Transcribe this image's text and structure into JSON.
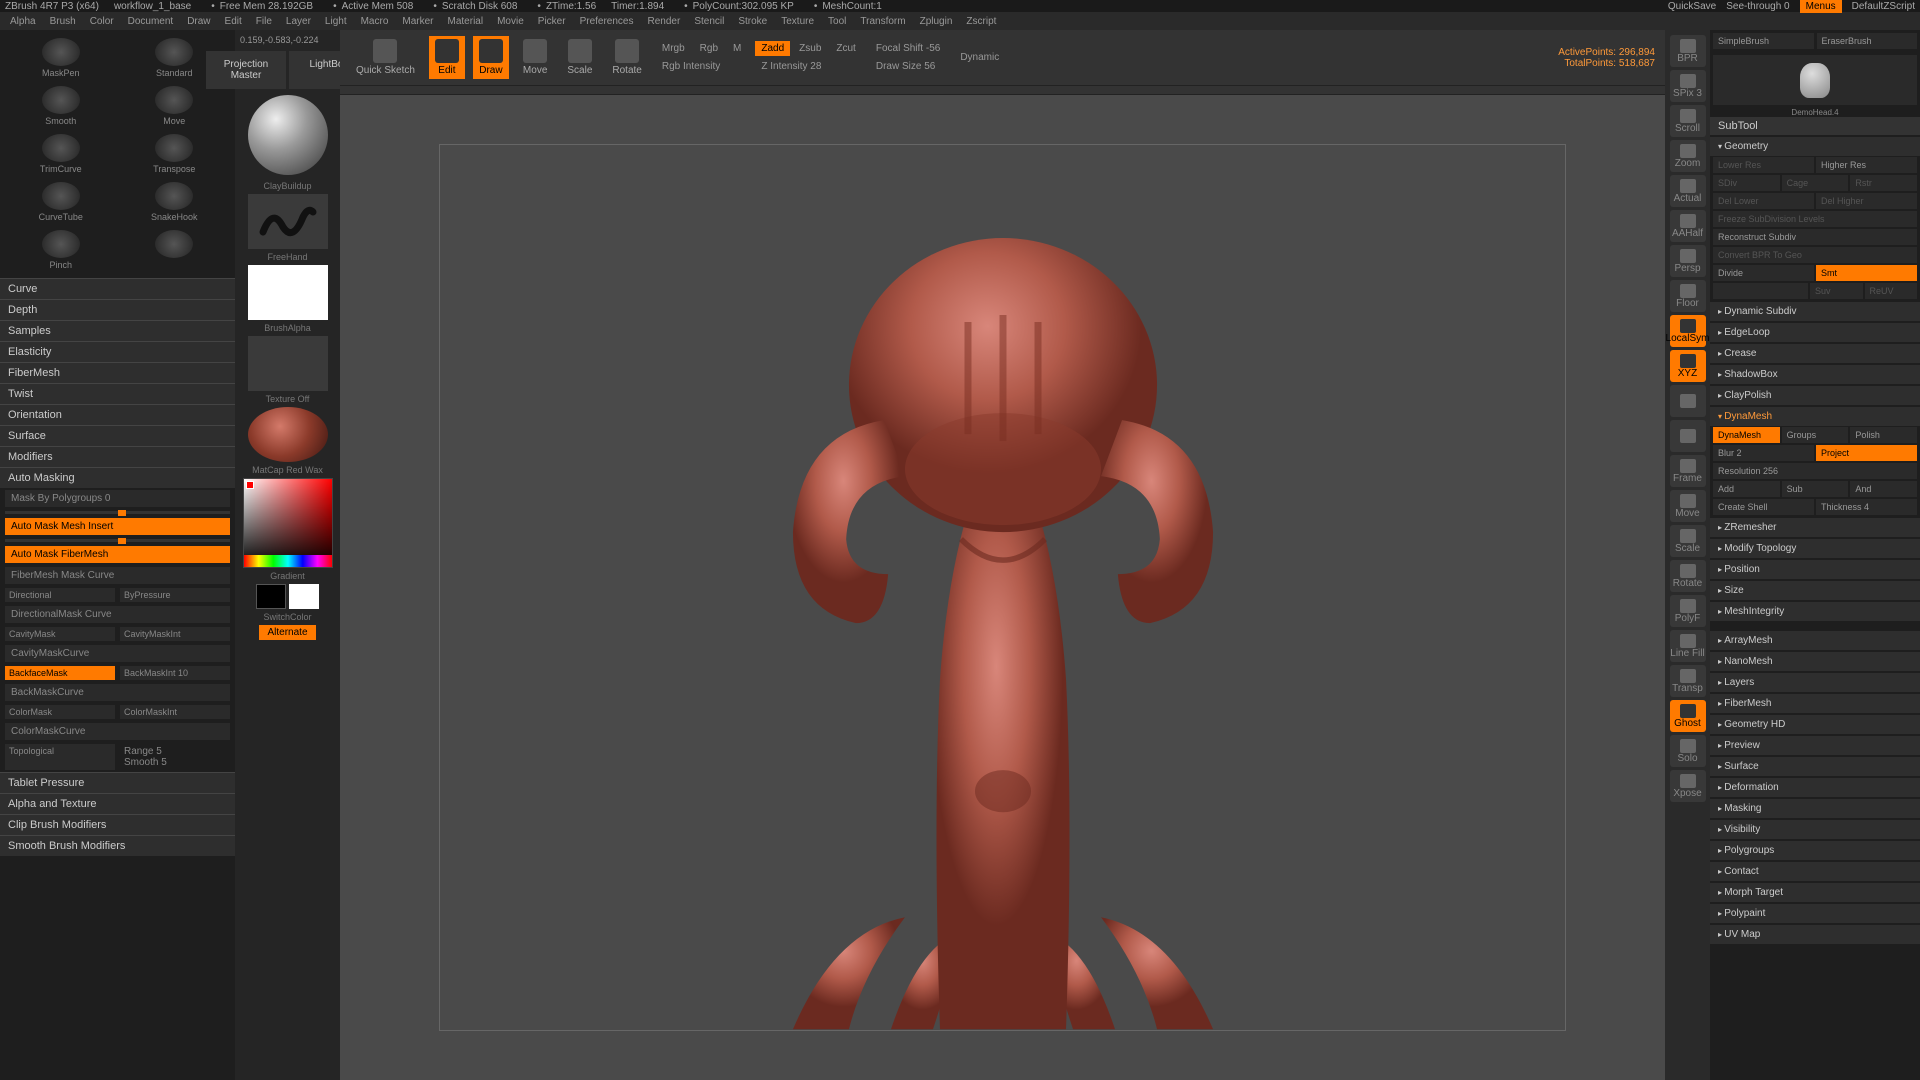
{
  "titlebar": {
    "app": "ZBrush 4R7 P3 (x64)",
    "file": "workflow_1_base",
    "mem_free": "Free Mem 28.192GB",
    "mem_active": "Active Mem 508",
    "scratch": "Scratch Disk 608",
    "ztime": "ZTime:1.56",
    "timer": "Timer:1.894",
    "polycount": "PolyCount:302.095 KP",
    "meshcount": "MeshCount:1",
    "quicksave": "QuickSave",
    "seethrough": "See-through  0",
    "menus": "Menus",
    "script": "DefaultZScript"
  },
  "menubar": [
    "Alpha",
    "Brush",
    "Color",
    "Document",
    "Draw",
    "Edit",
    "File",
    "Layer",
    "Light",
    "Macro",
    "Marker",
    "Material",
    "Movie",
    "Picker",
    "Preferences",
    "Render",
    "Stencil",
    "Stroke",
    "Texture",
    "Tool",
    "Transform",
    "Zplugin",
    "Zscript"
  ],
  "brushes": [
    {
      "label": "MaskPen"
    },
    {
      "label": "Standard"
    },
    {
      "label": "Smooth"
    },
    {
      "label": "Move"
    },
    {
      "label": "TrimCurve"
    },
    {
      "label": "Transpose"
    },
    {
      "label": "CurveTube"
    },
    {
      "label": "SnakeHook"
    },
    {
      "label": "Pinch"
    },
    {
      "label": ""
    }
  ],
  "left_sections": [
    "Curve",
    "Depth",
    "Samples",
    "Elasticity",
    "FiberMesh",
    "Twist",
    "Orientation",
    "Surface",
    "Modifiers"
  ],
  "automask": {
    "header": "Auto Masking",
    "polygroups": "Mask By Polygroups 0",
    "insert": "Auto Mask Mesh Insert",
    "fiber": "Auto Mask FiberMesh",
    "fibercurve": "FiberMesh Mask Curve",
    "directional": "Directional",
    "dirpressure": "ByPressure",
    "dircurve": "DirectionalMask Curve",
    "cavity": "CavityMask",
    "cavityint": "CavityMaskInt",
    "cavitycurve": "CavityMaskCurve",
    "backface": "BackfaceMask",
    "backint": "BackMaskInt 10",
    "backcurve": "BackMaskCurve",
    "colormask": "ColorMask",
    "colorint": "ColorMaskInt",
    "colorcurve": "ColorMaskCurve",
    "topo": "Topological",
    "range": "Range 5",
    "smooth": "Smooth 5"
  },
  "bottom_sections": [
    "Tablet Pressure",
    "Alpha and Texture",
    "Clip Brush Modifiers",
    "Smooth Brush Modifiers"
  ],
  "col2": {
    "coords": "0.159,-0.583,-0.224",
    "proj": "Projection Master",
    "lightbox": "LightBox",
    "brush": "ClayBuildup",
    "stroke": "FreeHand",
    "alpha": "BrushAlpha",
    "texture": "Texture Off",
    "matcap": "MatCap Red Wax",
    "gradient": "Gradient",
    "switch": "SwitchColor",
    "alternate": "Alternate"
  },
  "toolbar": {
    "quick": "Quick Sketch",
    "edit": "Edit",
    "draw": "Draw",
    "move": "Move",
    "scale": "Scale",
    "rotate": "Rotate",
    "mrgb": "Mrgb",
    "rgb": "Rgb",
    "m": "M",
    "rgbint": "Rgb Intensity",
    "zadd": "Zadd",
    "zsub": "Zsub",
    "zcut": "Zcut",
    "zint": "Z Intensity 28",
    "focal": "Focal Shift -56",
    "drawsize": "Draw Size 56",
    "dynamic": "Dynamic",
    "active": "ActivePoints: 296,894",
    "total": "TotalPoints: 518,687"
  },
  "rightnav": [
    "BPR",
    "SPix 3",
    "Scroll",
    "Zoom",
    "Actual",
    "AAHalf",
    "Persp",
    "Floor",
    "LocalSym",
    "XYZ",
    "",
    "",
    "Frame",
    "Move",
    "Scale",
    "Rotate",
    "PolyF",
    "Line Fill",
    "Transp",
    "Ghost",
    "Solo",
    "Xpose"
  ],
  "rightnav_active": [
    8,
    9,
    19
  ],
  "subtool": {
    "header": "SubTool",
    "thumb_label": "DemoHead.4",
    "geometry": "Geometry",
    "lower": "Lower Res",
    "higher": "Higher Res",
    "sdiv": "SDiv",
    "cage": "Cage",
    "rstr": "Rstr",
    "dellower": "Del Lower",
    "delhigher": "Del Higher",
    "freeze": "Freeze SubDivision Levels",
    "reconstruct": "Reconstruct Subdiv",
    "convert": "Convert BPR To Geo",
    "divide": "Divide",
    "smt": "Smt",
    "suv": "Suv",
    "resv": "ReUV",
    "dynsub": "Dynamic Subdiv",
    "edgeloop": "EdgeLoop",
    "crease": "Crease",
    "shadowbox": "ShadowBox",
    "claypolish": "ClayPolish",
    "dynamesh": "DynaMesh",
    "dynabtn": "DynaMesh",
    "groups": "Groups",
    "polish": "Polish",
    "blur": "Blur 2",
    "project": "Project",
    "resolution": "Resolution 256",
    "add": "Add",
    "sub": "Sub",
    "and": "And",
    "createshell": "Create Shell",
    "thickness": "Thickness 4",
    "zremesher": "ZRemesher",
    "modtopo": "Modify Topology",
    "position": "Position",
    "size": "Size",
    "meshint": "MeshIntegrity"
  },
  "rp_sections": [
    "ArrayMesh",
    "NanoMesh",
    "Layers",
    "FiberMesh",
    "Geometry HD",
    "Preview",
    "Surface",
    "Deformation",
    "Masking",
    "Visibility",
    "Polygroups",
    "Contact",
    "Morph Target",
    "Polypaint",
    "UV Map"
  ]
}
